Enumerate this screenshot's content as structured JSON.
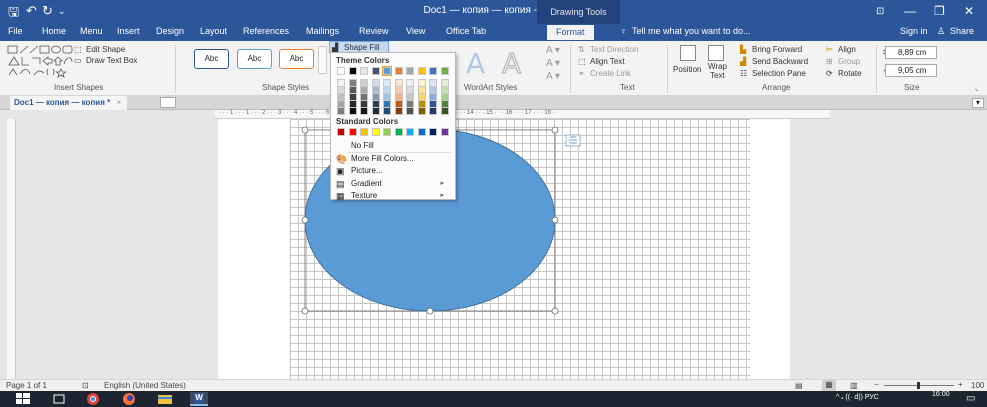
{
  "titlebar": {
    "document_title": "Doc1 — копия — копия - Word",
    "context_tools": "Drawing Tools",
    "qa_save": "🖫",
    "qa_undo": "↶",
    "qa_redo": "↻",
    "qa_more": "⌄",
    "ctrl_ribbon_opts": "⊡",
    "ctrl_minimize": "—",
    "ctrl_restore": "❐",
    "ctrl_close": "✕"
  },
  "tabs": [
    "File",
    "Home",
    "Menu",
    "Insert",
    "Design",
    "Layout",
    "References",
    "Mailings",
    "Review",
    "View",
    "Office Tab",
    "Format"
  ],
  "active_tab": "Format",
  "tell_me": "Tell me what you want to do...",
  "sign_in": "Sign in",
  "share": "Share",
  "ribbon": {
    "insert_shapes": {
      "label": "Insert Shapes",
      "edit_shape": "Edit Shape",
      "draw_text_box": "Draw Text Box"
    },
    "shape_styles": {
      "label": "Shape Styles",
      "style_sample": "Abc",
      "shape_fill": "Shape Fill"
    },
    "wordart_styles": {
      "label": "WordArt Styles",
      "letter": "A"
    },
    "text": {
      "label": "Text",
      "text_direction": "Text Direction",
      "align_text": "Align Text",
      "create_link": "Create Link"
    },
    "arrange": {
      "label": "Arrange",
      "position": "Position",
      "wrap_text_1": "Wrap",
      "wrap_text_2": "Text",
      "bring_forward": "Bring Forward",
      "send_backward": "Send Backward",
      "selection_pane": "Selection Pane",
      "align": "Align",
      "group": "Group",
      "rotate": "Rotate"
    },
    "size": {
      "label": "Size",
      "height": "8,89 cm",
      "width": "9,05 cm"
    }
  },
  "doc_tab": {
    "name": "Doc1 — копия — копия *",
    "close": "×"
  },
  "ruler": {
    "marks": "· · · 1 · · · 1 · · · 2 · · · 3 · · · 4 · · · 5 · · · 6 · · · 7 · · · 8 · · · 9 · · · 10 · · · 11 · · · 12 · · · 13 · · · 14 · · · 15 · · · 16 · · · 17 · · · 18 ·"
  },
  "shape_fill_menu": {
    "theme_colors_header": "Theme Colors",
    "theme_top_row": [
      "#ffffff",
      "#000000",
      "#e7e6e6",
      "#44546a",
      "#5b9bd5",
      "#ed7d31",
      "#a5a5a5",
      "#ffc000",
      "#4472c4",
      "#70ad47"
    ],
    "theme_tint_rows": [
      [
        "#f2f2f2",
        "#7f7f7f",
        "#d0cece",
        "#d6dce4",
        "#deebf6",
        "#fbe5d5",
        "#ededed",
        "#fff2cc",
        "#dae3f3",
        "#e2efd9"
      ],
      [
        "#d8d8d8",
        "#595959",
        "#aeabab",
        "#adb9ca",
        "#bdd7ee",
        "#f7cbac",
        "#dbdbdb",
        "#fee599",
        "#b4c6e7",
        "#c5e0b3"
      ],
      [
        "#bfbfbf",
        "#3f3f3f",
        "#757070",
        "#8496b0",
        "#9cc3e5",
        "#f4b183",
        "#c9c9c9",
        "#ffd965",
        "#8eaadb",
        "#a8d08d"
      ],
      [
        "#a5a5a5",
        "#262626",
        "#3a3838",
        "#323f4f",
        "#2e75b5",
        "#c55a11",
        "#7b7b7b",
        "#bf9000",
        "#2f5496",
        "#538135"
      ],
      [
        "#7f7f7f",
        "#0c0c0c",
        "#171616",
        "#222a35",
        "#1e4e79",
        "#833c0b",
        "#525252",
        "#7f6000",
        "#1f3864",
        "#375623"
      ]
    ],
    "standard_colors_header": "Standard Colors",
    "standard_colors": [
      "#c00000",
      "#ff0000",
      "#ffc000",
      "#ffff00",
      "#92d050",
      "#00b050",
      "#00b0f0",
      "#0070c0",
      "#002060",
      "#7030a0"
    ],
    "items": [
      {
        "name": "no-fill",
        "label": "No Fill",
        "icon": "",
        "arrow": ""
      },
      {
        "name": "more-fill-colors",
        "label": "More Fill Colors...",
        "icon": "🎨",
        "arrow": ""
      },
      {
        "name": "picture",
        "label": "Picture...",
        "icon": "▣",
        "arrow": ""
      },
      {
        "name": "gradient",
        "label": "Gradient",
        "icon": "▤",
        "arrow": "▸"
      },
      {
        "name": "texture",
        "label": "Texture",
        "icon": "▦",
        "arrow": "▸"
      }
    ]
  },
  "shape": {
    "fill": "#5b9bd5",
    "stroke": "#41719c"
  },
  "status": {
    "page": "Page 1 of 1",
    "language": "English (United States)",
    "zoom_minus": "−",
    "zoom_plus": "+",
    "zoom": "100"
  },
  "taskbar": {
    "tray_text": "^ 𝅘  ((·  d))  РУС",
    "time": "16:00",
    "word_label": "W"
  }
}
